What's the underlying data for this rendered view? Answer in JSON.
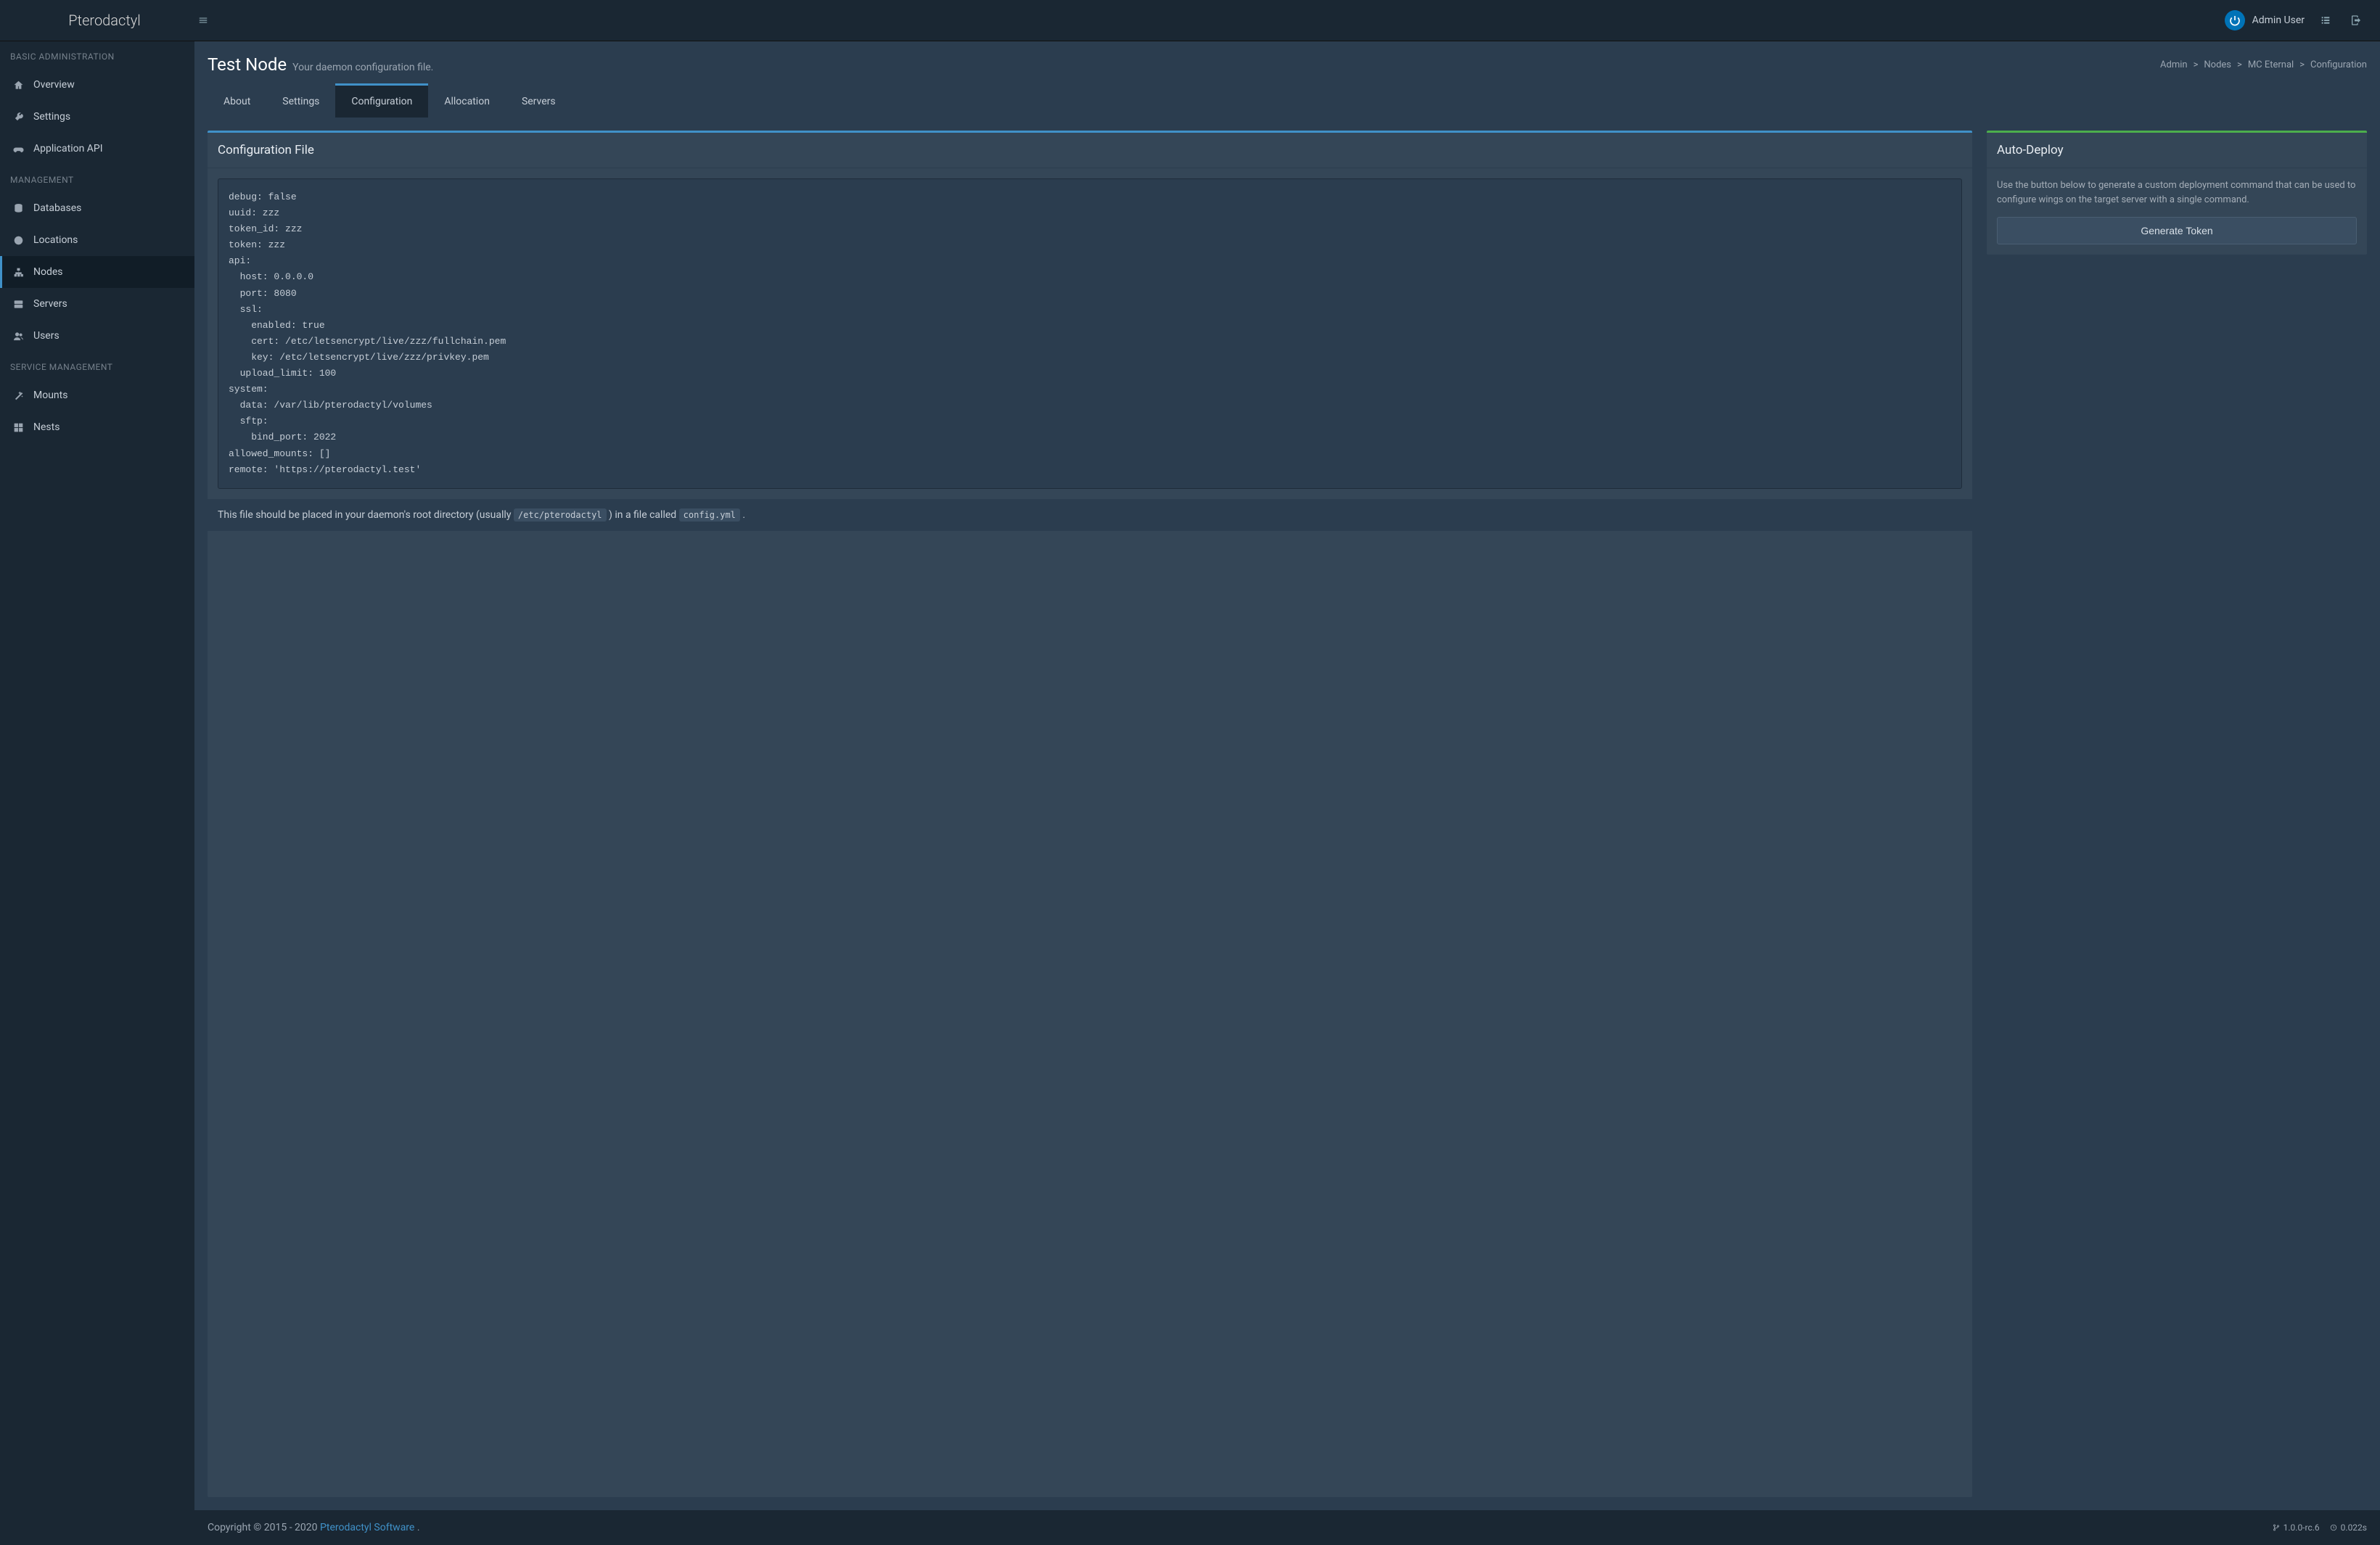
{
  "brand": "Pterodactyl",
  "user": {
    "name": "Admin User"
  },
  "sidebar": {
    "sections": [
      {
        "title": "BASIC ADMINISTRATION",
        "items": [
          {
            "label": "Overview",
            "icon": "home"
          },
          {
            "label": "Settings",
            "icon": "wrench"
          },
          {
            "label": "Application API",
            "icon": "gamepad"
          }
        ]
      },
      {
        "title": "MANAGEMENT",
        "items": [
          {
            "label": "Databases",
            "icon": "database"
          },
          {
            "label": "Locations",
            "icon": "globe"
          },
          {
            "label": "Nodes",
            "icon": "sitemap",
            "active": true
          },
          {
            "label": "Servers",
            "icon": "server"
          },
          {
            "label": "Users",
            "icon": "users"
          }
        ]
      },
      {
        "title": "SERVICE MANAGEMENT",
        "items": [
          {
            "label": "Mounts",
            "icon": "magic"
          },
          {
            "label": "Nests",
            "icon": "th-large"
          }
        ]
      }
    ]
  },
  "page": {
    "title": "Test Node",
    "subtitle": "Your daemon configuration file."
  },
  "breadcrumb": {
    "items": [
      "Admin",
      "Nodes",
      "MC Eternal",
      "Configuration"
    ]
  },
  "tabs": {
    "items": [
      "About",
      "Settings",
      "Configuration",
      "Allocation",
      "Servers"
    ],
    "active": "Configuration"
  },
  "config_panel": {
    "title": "Configuration File",
    "code": "debug: false\nuuid: zzz\ntoken_id: zzz\ntoken: zzz\napi:\n  host: 0.0.0.0\n  port: 8080\n  ssl:\n    enabled: true\n    cert: /etc/letsencrypt/live/zzz/fullchain.pem\n    key: /etc/letsencrypt/live/zzz/privkey.pem\n  upload_limit: 100\nsystem:\n  data: /var/lib/pterodactyl/volumes\n  sftp:\n    bind_port: 2022\nallowed_mounts: []\nremote: 'https://pterodactyl.test'",
    "footer_pre": "This file should be placed in your daemon's root directory (usually ",
    "footer_code1": "/etc/pterodactyl",
    "footer_mid": " ) in a file called ",
    "footer_code2": "config.yml",
    "footer_post": " ."
  },
  "deploy_panel": {
    "title": "Auto-Deploy",
    "help": "Use the button below to generate a custom deployment command that can be used to configure wings on the target server with a single command.",
    "button": "Generate Token"
  },
  "footer": {
    "copyright_pre": "Copyright © 2015 - 2020 ",
    "copyright_link": "Pterodactyl Software",
    "copyright_post": ".",
    "version": "1.0.0-rc.6",
    "time": "0.022s"
  }
}
